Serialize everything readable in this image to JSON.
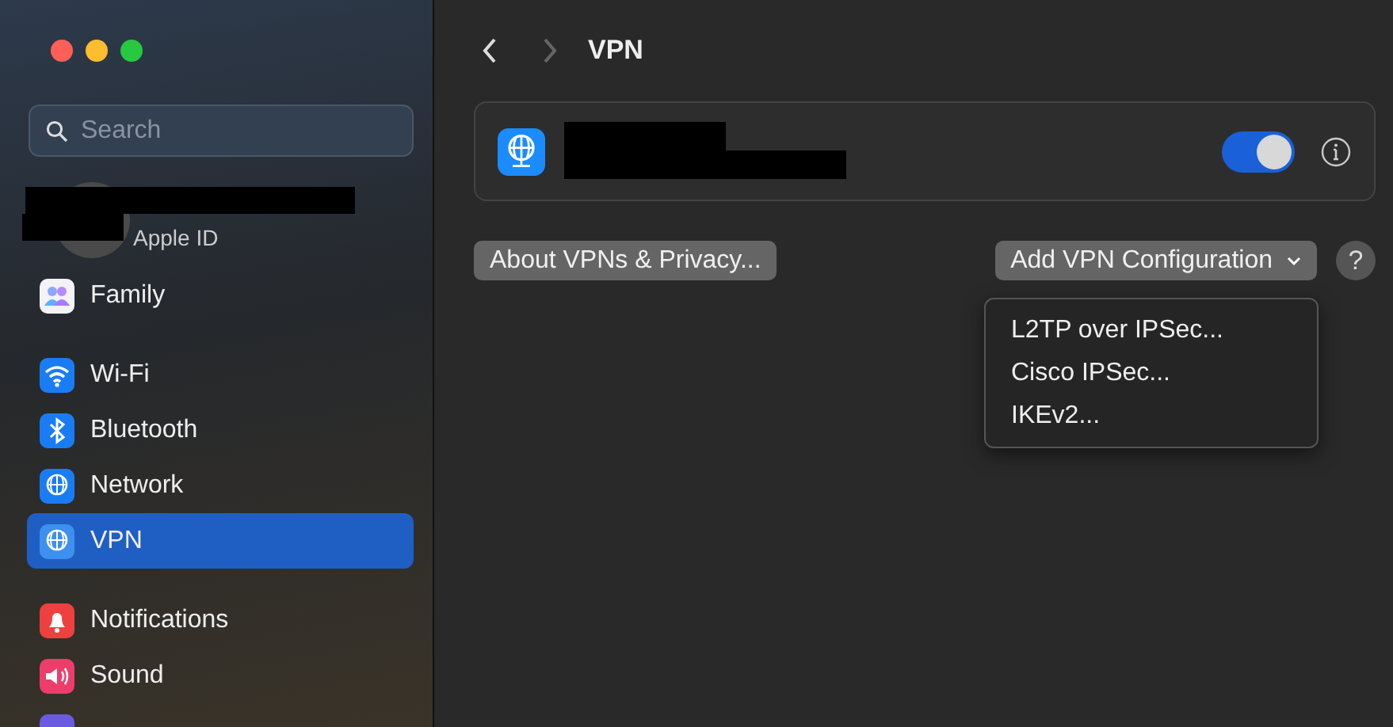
{
  "sidebar": {
    "search": {
      "placeholder": "Search"
    },
    "account": {
      "subtitle": "Apple ID"
    },
    "groups": [
      [
        {
          "label": "Family",
          "kind": "family",
          "selected": false
        }
      ],
      [
        {
          "label": "Wi-Fi",
          "kind": "wifi",
          "selected": false
        },
        {
          "label": "Bluetooth",
          "kind": "bluetooth",
          "selected": false
        },
        {
          "label": "Network",
          "kind": "network",
          "selected": false
        },
        {
          "label": "VPN",
          "kind": "vpn",
          "selected": true
        }
      ],
      [
        {
          "label": "Notifications",
          "kind": "notifications",
          "selected": false
        },
        {
          "label": "Sound",
          "kind": "sound",
          "selected": false
        },
        {
          "kind": "focus",
          "selected": false
        }
      ]
    ]
  },
  "toolbar": {
    "title": "VPN",
    "back_enabled": true,
    "forward_enabled": false
  },
  "vpn_entry": {
    "on": true
  },
  "buttons": {
    "about": "About VPNs & Privacy...",
    "add": "Add VPN Configuration",
    "help": "?"
  },
  "menu": [
    "L2TP over IPSec...",
    "Cisco IPSec...",
    "IKEv2..."
  ]
}
